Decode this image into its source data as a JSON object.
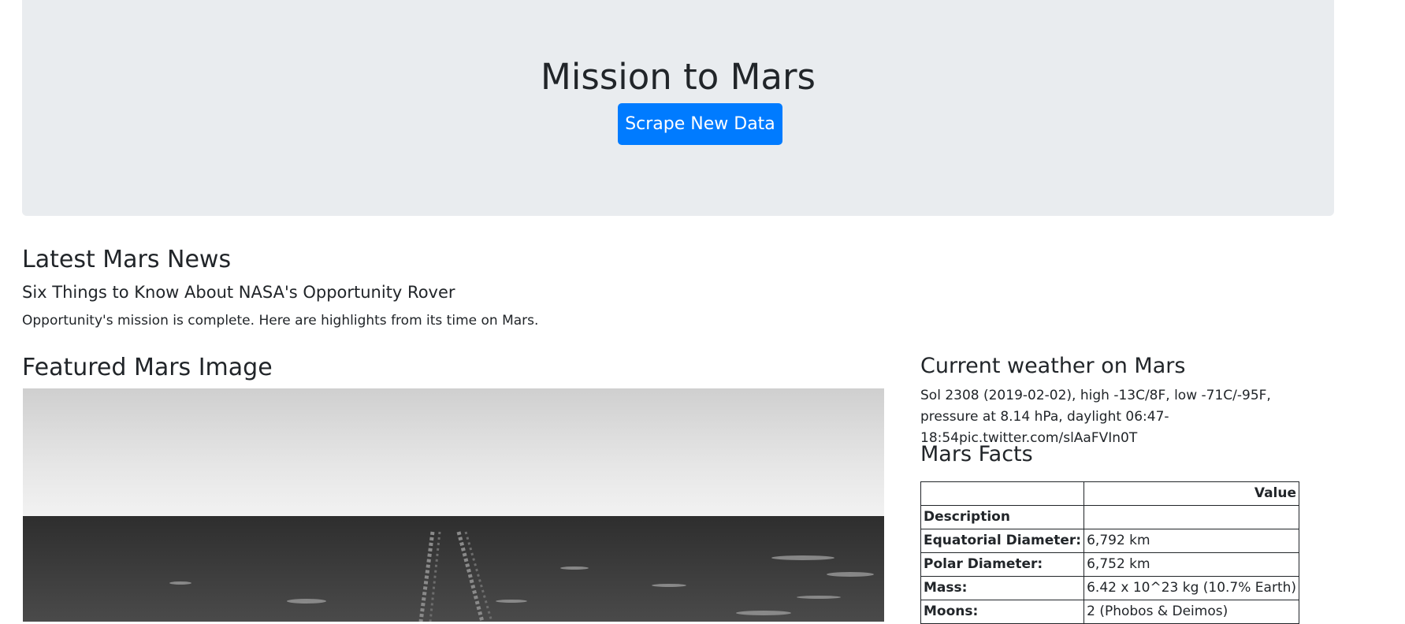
{
  "header": {
    "title": "Mission to Mars",
    "scrape_button": "Scrape New Data"
  },
  "news": {
    "heading": "Latest Mars News",
    "title": "Six Things to Know About NASA's Opportunity Rover",
    "paragraph": "Opportunity's mission is complete. Here are highlights from its time on Mars."
  },
  "featured_image": {
    "heading": "Featured Mars Image"
  },
  "weather": {
    "heading": "Current weather on Mars",
    "text": "Sol 2308 (2019-02-02), high -13C/8F, low -71C/-95F, pressure at 8.14 hPa, daylight 06:47-18:54pic.twitter.com/slAaFVIn0T"
  },
  "facts": {
    "heading": "Mars Facts",
    "columns": [
      "",
      "Value"
    ],
    "index_name": "Description",
    "rows": [
      {
        "label": "Equatorial Diameter:",
        "value": "6,792 km"
      },
      {
        "label": "Polar Diameter:",
        "value": "6,752 km"
      },
      {
        "label": "Mass:",
        "value": "6.42 x 10^23 kg (10.7% Earth)"
      },
      {
        "label": "Moons:",
        "value": "2 (Phobos & Deimos)"
      }
    ]
  },
  "colors": {
    "jumbotron_bg": "#e9ecef",
    "primary": "#007bff",
    "text": "#212529"
  }
}
